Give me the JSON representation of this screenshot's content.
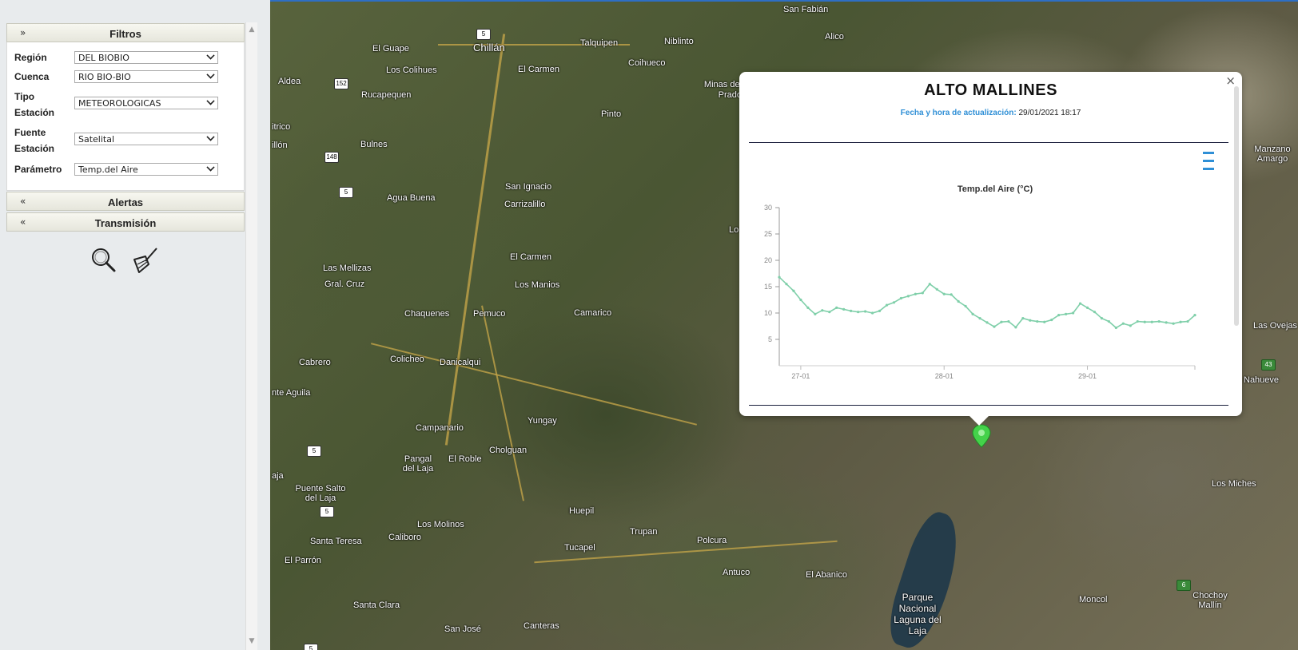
{
  "sidebar": {
    "filters_title": "Filtros",
    "fields": [
      {
        "label": "Región",
        "value": "DEL BIOBIO"
      },
      {
        "label": "Cuenca",
        "value": "RIO BIO-BIO"
      },
      {
        "label": "Tipo Estación",
        "label_lines": [
          "Tipo",
          "Estación"
        ],
        "value": "METEOROLOGICAS"
      },
      {
        "label": "Fuente Estación",
        "label_lines": [
          "Fuente",
          "Estación"
        ],
        "value": "Satelital"
      },
      {
        "label": "Parámetro",
        "value": "Temp.del Aire"
      }
    ],
    "alerts_title": "Alertas",
    "transmission_title": "Transmisión",
    "search_icon": "magnifier-icon",
    "clear_icon": "broom-icon"
  },
  "map": {
    "places": [
      "San Fabián",
      "Alico",
      "El Guape",
      "Chillán",
      "Talquipen",
      "Niblinto",
      "Los Colihues",
      "El Carmen",
      "Coihueco",
      "Minas del Prado",
      "Aldea",
      "Rucapequen",
      "Pinto",
      "itrico",
      "illón",
      "Bulnes",
      "San Ignacio",
      "Carrizalillo",
      "Agua Buena",
      "Las Mellizas",
      "Gral. Cruz",
      "El Carmen",
      "Los Manios",
      "Chaquenes",
      "Pemuco",
      "Camarico",
      "Cabrero",
      "Colicheo",
      "Danicalqui",
      "nte Aguila",
      "Yungay",
      "Campanario",
      "Cholguan",
      "Pangal del Laja",
      "El Roble",
      "aja",
      "Puente Salto del Laja",
      "Los Molinos",
      "Caliboro",
      "Huepil",
      "Trupan",
      "Polcura",
      "Santa Teresa",
      "El Parrón",
      "Tucapel",
      "Antuco",
      "El Abanico",
      "Santa Clara",
      "San José",
      "Canteras",
      "Parque Nacional Laguna del Laja",
      "Moncol",
      "Chochoy Mallín",
      "Los Miches",
      "Nahueve",
      "Las Ovejas",
      "Manzano Amargo",
      "Lo"
    ],
    "route_shields": [
      "5",
      "152",
      "148",
      "5",
      "5",
      "5",
      "5",
      "43",
      "6"
    ]
  },
  "popup": {
    "station_name": "ALTO MALLINES",
    "update_label": "Fecha y hora de actualización:",
    "update_value": "29/01/2021 18:17",
    "close_glyph": "×"
  },
  "chart_data": {
    "type": "line",
    "title": "Temp.del Aire (°C)",
    "xlabel": "",
    "ylabel": "",
    "ylim": [
      0,
      30
    ],
    "yticks": [
      5,
      10,
      15,
      20,
      25,
      30
    ],
    "xticks": [
      "27-01",
      "28-01",
      "29-01"
    ],
    "x_range_days": [
      -0.15,
      2.75
    ],
    "series": [
      {
        "color": "#7fcfa9",
        "x": [
          -0.15,
          -0.1,
          -0.05,
          0.0,
          0.05,
          0.1,
          0.15,
          0.2,
          0.25,
          0.3,
          0.35,
          0.4,
          0.45,
          0.5,
          0.55,
          0.6,
          0.65,
          0.7,
          0.75,
          0.8,
          0.85,
          0.9,
          0.95,
          1.0,
          1.05,
          1.1,
          1.15,
          1.2,
          1.25,
          1.3,
          1.35,
          1.4,
          1.45,
          1.5,
          1.55,
          1.6,
          1.65,
          1.7,
          1.75,
          1.8,
          1.85,
          1.9,
          1.95,
          2.0,
          2.05,
          2.1,
          2.15,
          2.2,
          2.25,
          2.3,
          2.35,
          2.4,
          2.45,
          2.5,
          2.55,
          2.6,
          2.65,
          2.7,
          2.75
        ],
        "y": [
          16.8,
          15.5,
          14.2,
          12.5,
          11.0,
          9.8,
          10.5,
          10.2,
          11.0,
          10.7,
          10.4,
          10.2,
          10.3,
          10.0,
          10.4,
          11.5,
          12.0,
          12.8,
          13.2,
          13.6,
          13.8,
          15.5,
          14.5,
          13.6,
          13.5,
          12.2,
          11.3,
          9.8,
          9.0,
          8.2,
          7.4,
          8.3,
          8.4,
          7.3,
          9.0,
          8.6,
          8.4,
          8.3,
          8.7,
          9.6,
          9.8,
          10.0,
          11.8,
          11.0,
          10.2,
          9.0,
          8.4,
          7.2,
          8.0,
          7.6,
          8.4,
          8.3,
          8.3,
          8.4,
          8.2,
          8.0,
          8.3,
          8.4,
          9.6
        ]
      }
    ]
  }
}
